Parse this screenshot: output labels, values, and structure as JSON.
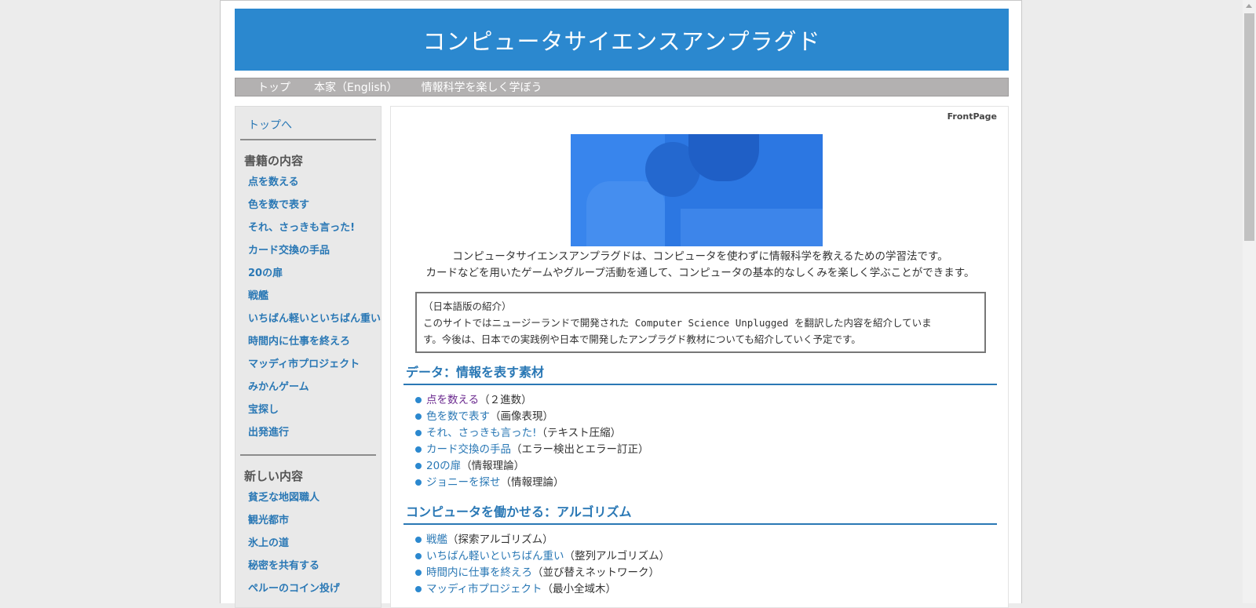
{
  "banner": {
    "title": "コンピュータサイエンスアンプラグド"
  },
  "topnav": {
    "items": [
      "トップ",
      "本家（English）",
      "情報科学を楽しく学ぼう"
    ]
  },
  "sidebar": {
    "top_link": "トップへ",
    "sections": [
      {
        "heading": "書籍の内容",
        "items": [
          "点を数える",
          "色を数で表す",
          "それ、さっきも言った!",
          "カード交換の手品",
          "20の扉",
          "戦艦",
          "いちばん軽いといちばん重い",
          "時間内に仕事を終えろ",
          "マッディ市プロジェクト",
          "みかんゲーム",
          "宝探し",
          "出発進行"
        ]
      },
      {
        "heading": "新しい内容",
        "items": [
          "貧乏な地図職人",
          "観光都市",
          "氷上の道",
          "秘密を共有する",
          "ペルーのコイン投げ"
        ]
      }
    ]
  },
  "main": {
    "page_name": "FrontPage",
    "intro_lines": [
      "コンピュータサイエンスアンプラグドは、コンピュータを使わずに情報科学を教えるための学習法です。",
      "カードなどを用いたゲームやグループ活動を通して、コンピュータの基本的なしくみを楽しく学ぶことができます。"
    ],
    "notice": {
      "title": "（日本語版の紹介）",
      "line1": "このサイトではニュージーランドで開発された Computer Science Unplugged を翻訳した内容を紹介していま",
      "line2": "す。今後は、日本での実践例や日本で開発したアンプラグド教材についても紹介していく予定です。"
    },
    "sections": [
      {
        "title": "データ：情報を表す素材",
        "items": [
          {
            "label": "点を数える",
            "note": "（２進数）"
          },
          {
            "label": "色を数で表す",
            "note": "（画像表現）"
          },
          {
            "label": "それ、さっきも言った!",
            "note": "（テキスト圧縮）"
          },
          {
            "label": "カード交換の手品",
            "note": "（エラー検出とエラー訂正）"
          },
          {
            "label": "20の扉",
            "note": "（情報理論）"
          },
          {
            "label": "ジョニーを探せ",
            "note": "（情報理論）"
          }
        ]
      },
      {
        "title": "コンピュータを働かせる：アルゴリズム",
        "items": [
          {
            "label": "戦艦",
            "note": "（探索アルゴリズム）"
          },
          {
            "label": "いちばん軽いといちばん重い",
            "note": "（整列アルゴリズム）"
          },
          {
            "label": "時間内に仕事を終えろ",
            "note": "（並び替えネットワーク）"
          },
          {
            "label": "マッディ市プロジェクト",
            "note": "（最小全域木）"
          }
        ]
      }
    ]
  },
  "colors": {
    "banner": "#2b88cf",
    "link": "#2a78b5",
    "nav_bg": "#b3b1b1",
    "sidebar_bg": "#e9e9e9"
  }
}
